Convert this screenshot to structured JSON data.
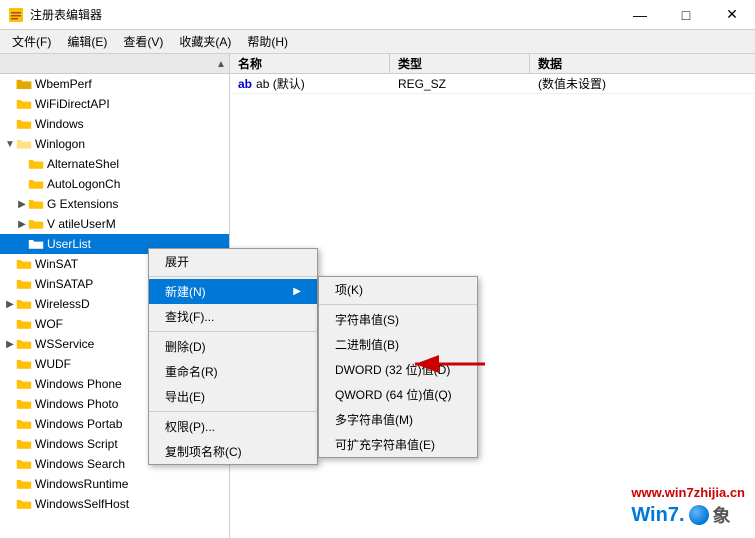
{
  "titleBar": {
    "icon": "🗂",
    "title": "注册表编辑器",
    "minimize": "—",
    "maximize": "□",
    "close": "✕"
  },
  "menuBar": {
    "items": [
      "文件(F)",
      "编辑(E)",
      "查看(V)",
      "收藏夹(A)",
      "帮助(H)"
    ]
  },
  "treePanel": {
    "items": [
      {
        "label": "WbemPerf",
        "indent": 0,
        "expandable": false,
        "expanded": false,
        "selected": false
      },
      {
        "label": "WiFiDirectAPI",
        "indent": 0,
        "expandable": false,
        "expanded": false,
        "selected": false
      },
      {
        "label": "Windows",
        "indent": 0,
        "expandable": false,
        "expanded": false,
        "selected": false
      },
      {
        "label": "Winlogon",
        "indent": 0,
        "expandable": true,
        "expanded": true,
        "selected": false
      },
      {
        "label": "AlternateShel",
        "indent": 1,
        "expandable": false,
        "expanded": false,
        "selected": false
      },
      {
        "label": "AutoLogonCh",
        "indent": 1,
        "expandable": false,
        "expanded": false,
        "selected": false
      },
      {
        "label": "G  Extensions",
        "indent": 1,
        "expandable": true,
        "expanded": false,
        "selected": false
      },
      {
        "label": "V  atileUserM",
        "indent": 1,
        "expandable": true,
        "expanded": false,
        "selected": false
      },
      {
        "label": "UserList",
        "indent": 1,
        "expandable": false,
        "expanded": false,
        "selected": true
      },
      {
        "label": "WinSAT",
        "indent": 0,
        "expandable": false,
        "expanded": false,
        "selected": false
      },
      {
        "label": "WinSATAP",
        "indent": 0,
        "expandable": false,
        "expanded": false,
        "selected": false
      },
      {
        "label": "WirelessD",
        "indent": 0,
        "expandable": true,
        "expanded": false,
        "selected": false
      },
      {
        "label": "WOF",
        "indent": 0,
        "expandable": false,
        "expanded": false,
        "selected": false
      },
      {
        "label": "WSService",
        "indent": 0,
        "expandable": true,
        "expanded": false,
        "selected": false
      },
      {
        "label": "WUDF",
        "indent": 0,
        "expandable": false,
        "expanded": false,
        "selected": false
      },
      {
        "label": "Windows Phone",
        "indent": 0,
        "expandable": false,
        "expanded": false,
        "selected": false
      },
      {
        "label": "Windows Photo",
        "indent": 0,
        "expandable": false,
        "expanded": false,
        "selected": false
      },
      {
        "label": "Windows Portab",
        "indent": 0,
        "expandable": false,
        "expanded": false,
        "selected": false
      },
      {
        "label": "Windows Script",
        "indent": 0,
        "expandable": false,
        "expanded": false,
        "selected": false
      },
      {
        "label": "Windows Search",
        "indent": 0,
        "expandable": false,
        "expanded": false,
        "selected": false
      },
      {
        "label": "WindowsRuntime",
        "indent": 0,
        "expandable": false,
        "expanded": false,
        "selected": false
      },
      {
        "label": "WindowsSelfHost",
        "indent": 0,
        "expandable": false,
        "expanded": false,
        "selected": false
      }
    ]
  },
  "rightPanel": {
    "columns": [
      "名称",
      "类型",
      "数据"
    ],
    "rows": [
      {
        "name": "ab (默认)",
        "type": "REG_SZ",
        "data": "(数值未设置)"
      }
    ]
  },
  "contextMenu": {
    "items": [
      {
        "label": "展开",
        "shortcut": "",
        "hasSubmenu": false,
        "separator": false
      },
      {
        "label": "新建(N)",
        "shortcut": "",
        "hasSubmenu": true,
        "separator": false,
        "highlighted": true
      },
      {
        "label": "查找(F)...",
        "shortcut": "",
        "hasSubmenu": false,
        "separator": true
      },
      {
        "label": "删除(D)",
        "shortcut": "",
        "hasSubmenu": false,
        "separator": false
      },
      {
        "label": "重命名(R)",
        "shortcut": "",
        "hasSubmenu": false,
        "separator": false
      },
      {
        "label": "导出(E)",
        "shortcut": "",
        "hasSubmenu": false,
        "separator": true
      },
      {
        "label": "权限(P)...",
        "shortcut": "",
        "hasSubmenu": false,
        "separator": false
      },
      {
        "label": "复制项名称(C)",
        "shortcut": "",
        "hasSubmenu": false,
        "separator": false
      }
    ],
    "subMenu": {
      "items": [
        {
          "label": "项(K)",
          "separator": false
        },
        {
          "label": "字符串值(S)",
          "separator": true
        },
        {
          "label": "二进制值(B)",
          "separator": false
        },
        {
          "label": "DWORD (32 位)值(D)",
          "separator": false
        },
        {
          "label": "QWORD (64 位)值(Q)",
          "separator": false
        },
        {
          "label": "多字符串值(M)",
          "separator": false
        },
        {
          "label": "可扩充字符串值(E)",
          "separator": false
        }
      ]
    }
  },
  "watermark": {
    "site": "www.win7zhijia.cn",
    "logo": "Win7.●象"
  }
}
